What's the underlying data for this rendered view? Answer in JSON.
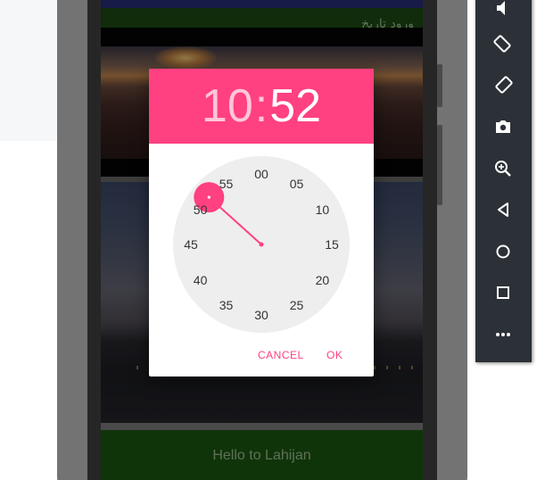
{
  "screen": {
    "top_text": "ورود تاريخ",
    "footer_text": "Hello to Lahijan"
  },
  "time_picker": {
    "hour": "10",
    "separator": ":",
    "minute": "52",
    "selected_minute": 52,
    "accent_color": "#ff4081",
    "minute_labels": [
      "00",
      "05",
      "10",
      "15",
      "20",
      "25",
      "30",
      "35",
      "40",
      "45",
      "50",
      "55"
    ],
    "cancel_label": "CANCEL",
    "ok_label": "OK"
  },
  "toolbar": {
    "icons": [
      "volume-down-icon",
      "rotate-left-icon",
      "rotate-right-icon",
      "camera-icon",
      "zoom-icon",
      "back-icon",
      "home-icon",
      "overview-icon",
      "more-icon"
    ]
  }
}
